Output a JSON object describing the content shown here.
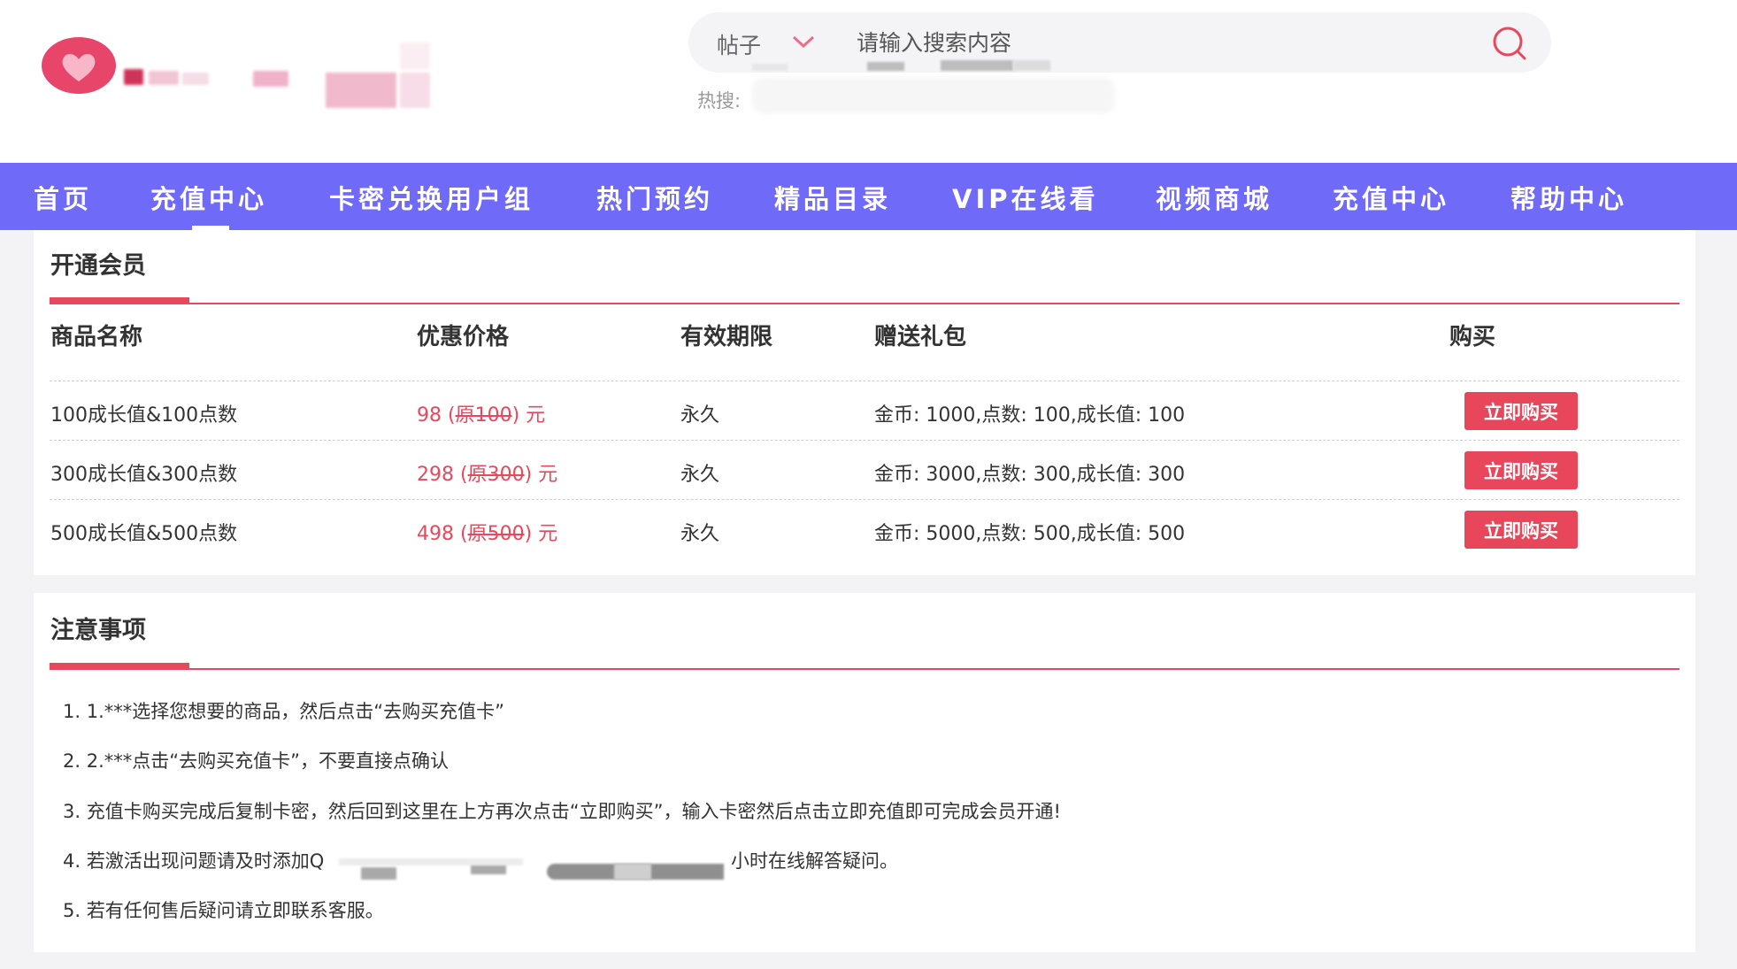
{
  "search": {
    "type_label": "帖子",
    "placeholder": "请输入搜索内容",
    "hot_label": "热搜:"
  },
  "nav": {
    "items": [
      "首页",
      "充值中心",
      "卡密兑换用户组",
      "热门预约",
      "精品目录",
      "VIP在线看",
      "视频商城",
      "充值中心",
      "帮助中心"
    ],
    "active_index": 1
  },
  "membership": {
    "title": "开通会员",
    "headers": [
      "商品名称",
      "优惠价格",
      "有效期限",
      "赠送礼包",
      "购买"
    ],
    "rows": [
      {
        "name": "100成长值&100点数",
        "price": "98",
        "original": "原100",
        "unit": "元",
        "duration": "永久",
        "gift": "金币: 1000,点数: 100,成长值: 100",
        "button": "立即购买"
      },
      {
        "name": "300成长值&300点数",
        "price": "298",
        "original": "原300",
        "unit": "元",
        "duration": "永久",
        "gift": "金币: 3000,点数: 300,成长值: 300",
        "button": "立即购买"
      },
      {
        "name": "500成长值&500点数",
        "price": "498",
        "original": "原500",
        "unit": "元",
        "duration": "永久",
        "gift": "金币: 5000,点数: 500,成长值: 500",
        "button": "立即购买"
      }
    ]
  },
  "notes": {
    "title": "注意事项",
    "items": [
      "1. 1.***选择您想要的商品，然后点击“去购买充值卡”",
      "2. 2.***点击“去购买充值卡”，不要直接点确认",
      "3. 充值卡购买完成后复制卡密，然后回到这里在上方再次点击“立即购买”，输入卡密然后点击立即充值即可完成会员开通!",
      "4. 若激活出现问题请及时添加Q",
      "5. 若有任何售后疑问请立即联系客服。"
    ],
    "item4_tail": "小时在线解答疑问。"
  },
  "colors": {
    "nav_bg": "#6f6af7",
    "accent": "#e8485c",
    "button": "#e8465a",
    "logo": "#e8456a"
  }
}
